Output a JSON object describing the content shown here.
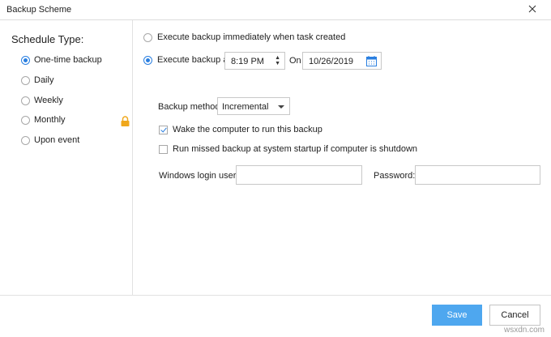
{
  "window": {
    "title": "Backup Scheme"
  },
  "sidebar": {
    "heading": "Schedule Type:",
    "items": [
      {
        "label": "One-time backup",
        "selected": true
      },
      {
        "label": "Daily",
        "selected": false
      },
      {
        "label": "Weekly",
        "selected": false
      },
      {
        "label": "Monthly",
        "selected": false
      },
      {
        "label": "Upon event",
        "selected": false,
        "locked": true
      }
    ]
  },
  "main": {
    "option_immediate": "Execute backup immediately when task created",
    "option_at": "Execute backup at",
    "time_value": "8:19 PM",
    "on_label": "On",
    "date_value": "10/26/2019",
    "backup_method_label": "Backup method",
    "backup_method_value": "Incremental",
    "wake_label": "Wake the computer to run this backup",
    "wake_checked": true,
    "missed_label": "Run missed backup at system startup if computer is shutdown",
    "missed_checked": false,
    "windows_login_label": "Windows login user:",
    "windows_login_value": "",
    "password_label": "Password:",
    "password_value": ""
  },
  "footer": {
    "save_label": "Save",
    "cancel_label": "Cancel"
  },
  "watermark": "wsxdn.com",
  "colors": {
    "accent": "#2a7fe0",
    "save_bg": "#4ea7ef",
    "lock": "#f0a81c"
  },
  "icons": {
    "close": "close-icon",
    "lock": "lock-icon",
    "calendar": "calendar-icon",
    "spinner": "spinner-icon"
  }
}
